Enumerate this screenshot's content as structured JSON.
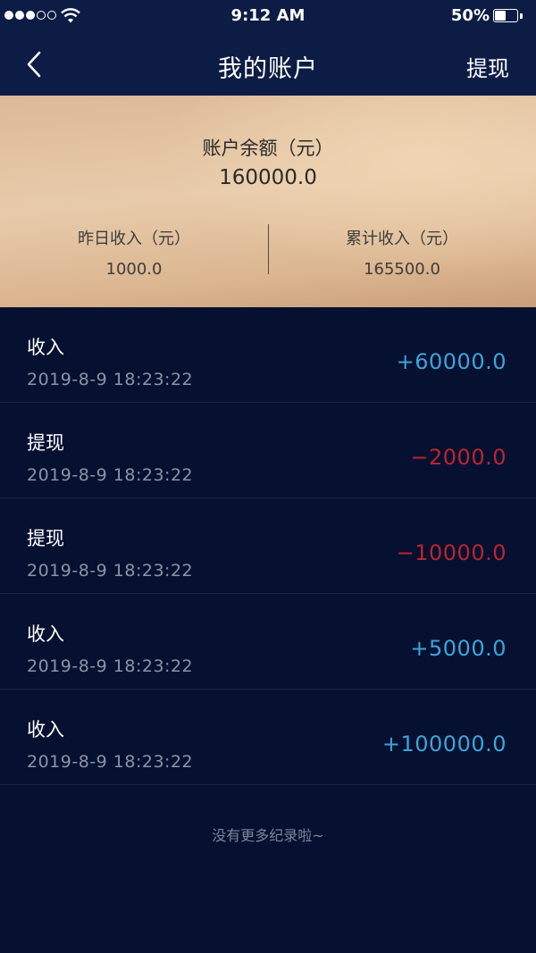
{
  "status_bar": {
    "time": "9:12 AM",
    "battery_percent": "50%",
    "battery_level": 0.5,
    "signal_bars_filled": 3,
    "signal_bars_total": 5
  },
  "nav": {
    "title": "我的账户",
    "withdraw_label": "提现",
    "back_icon": "chevron-left-icon"
  },
  "balance": {
    "label": "账户余额（元）",
    "value": "160000.0",
    "yesterday_label": "昨日收入（元）",
    "yesterday_value": "1000.0",
    "total_label": "累计收入（元）",
    "total_value": "165500.0"
  },
  "records": [
    {
      "type": "收入",
      "time": "2019-8-9 18:23:22",
      "amount": "+60000.0",
      "kind": "income"
    },
    {
      "type": "提现",
      "time": "2019-8-9 18:23:22",
      "amount": "−2000.0",
      "kind": "withdraw"
    },
    {
      "type": "提现",
      "time": "2019-8-9 18:23:22",
      "amount": "−10000.0",
      "kind": "withdraw"
    },
    {
      "type": "收入",
      "time": "2019-8-9 18:23:22",
      "amount": "+5000.0",
      "kind": "income"
    },
    {
      "type": "收入",
      "time": "2019-8-9 18:23:22",
      "amount": "+100000.0",
      "kind": "income"
    }
  ],
  "footer_note": "没有更多纪录啦~",
  "colors": {
    "income": "#3aa5dc",
    "withdraw": "#b8252f",
    "background": "#061030",
    "header": "#0c1c44"
  }
}
